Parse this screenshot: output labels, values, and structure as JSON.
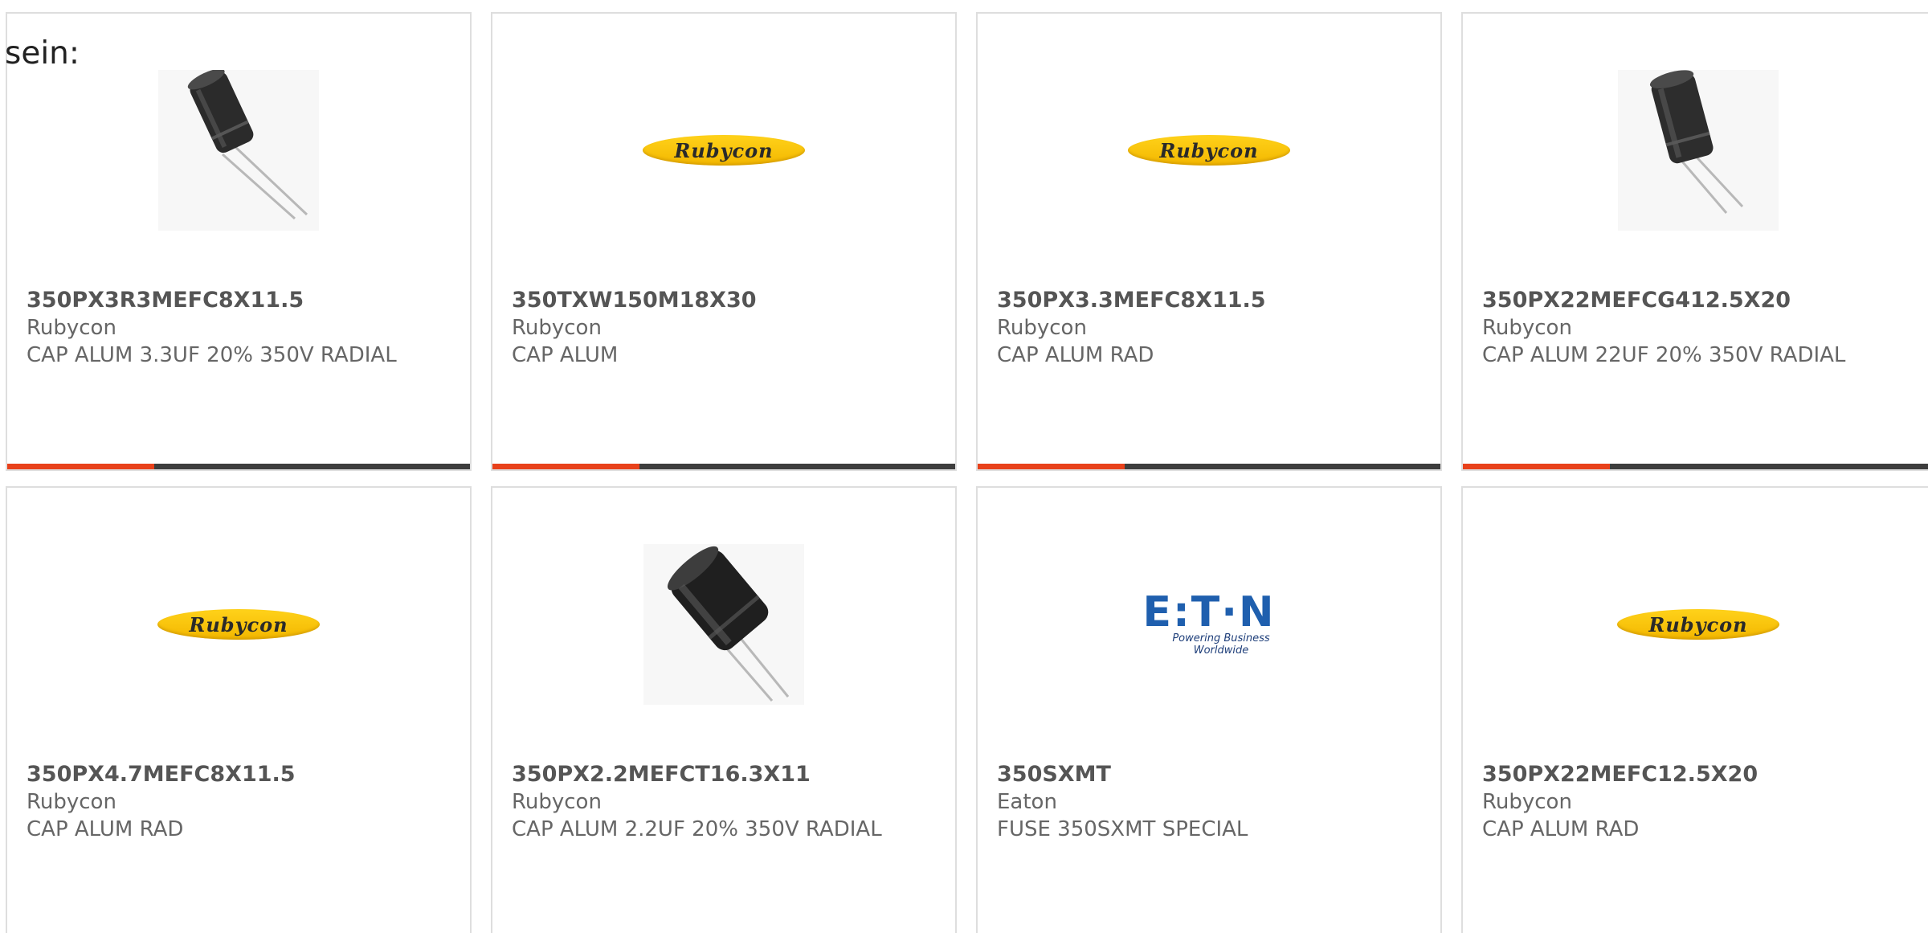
{
  "intro_text": "sein:",
  "colors": {
    "accent": "#e8411b",
    "bar_dark": "#3d3d3d",
    "rubycon_yellow": "#f3b700",
    "eaton_blue": "#1f5fae"
  },
  "products": [
    {
      "part_number": "350PX3R3MEFC8X11.5",
      "manufacturer": "Rubycon",
      "description": "CAP ALUM 3.3UF 20% 350V RADIAL",
      "image": "capacitor-photo-small",
      "accent_bar": true
    },
    {
      "part_number": "350TXW150M18X30",
      "manufacturer": "Rubycon",
      "description": "CAP ALUM",
      "image": "rubycon-logo",
      "logo_text": "Rubycon",
      "accent_bar": true
    },
    {
      "part_number": "350PX3.3MEFC8X11.5",
      "manufacturer": "Rubycon",
      "description": "CAP ALUM RAD",
      "image": "rubycon-logo",
      "logo_text": "Rubycon",
      "accent_bar": true
    },
    {
      "part_number": "350PX22MEFCG412.5X20",
      "manufacturer": "Rubycon",
      "description": "CAP ALUM 22UF 20% 350V RADIAL",
      "image": "capacitor-photo-small",
      "accent_bar": true
    },
    {
      "part_number": "350PX4.7MEFC8X11.5",
      "manufacturer": "Rubycon",
      "description": "CAP ALUM RAD",
      "image": "rubycon-logo",
      "logo_text": "Rubycon",
      "accent_bar": false
    },
    {
      "part_number": "350PX2.2MEFCT16.3X11",
      "manufacturer": "Rubycon",
      "description": "CAP ALUM 2.2UF 20% 350V RADIAL",
      "image": "capacitor-photo-large",
      "accent_bar": false
    },
    {
      "part_number": "350SXMT",
      "manufacturer": "Eaton",
      "description": "FUSE 350SXMT SPECIAL",
      "image": "eaton-logo",
      "logo_text": "E:T·N",
      "logo_tagline": "Powering Business Worldwide",
      "accent_bar": false
    },
    {
      "part_number": "350PX22MEFC12.5X20",
      "manufacturer": "Rubycon",
      "description": "CAP ALUM RAD",
      "image": "rubycon-logo",
      "logo_text": "Rubycon",
      "accent_bar": false
    }
  ]
}
